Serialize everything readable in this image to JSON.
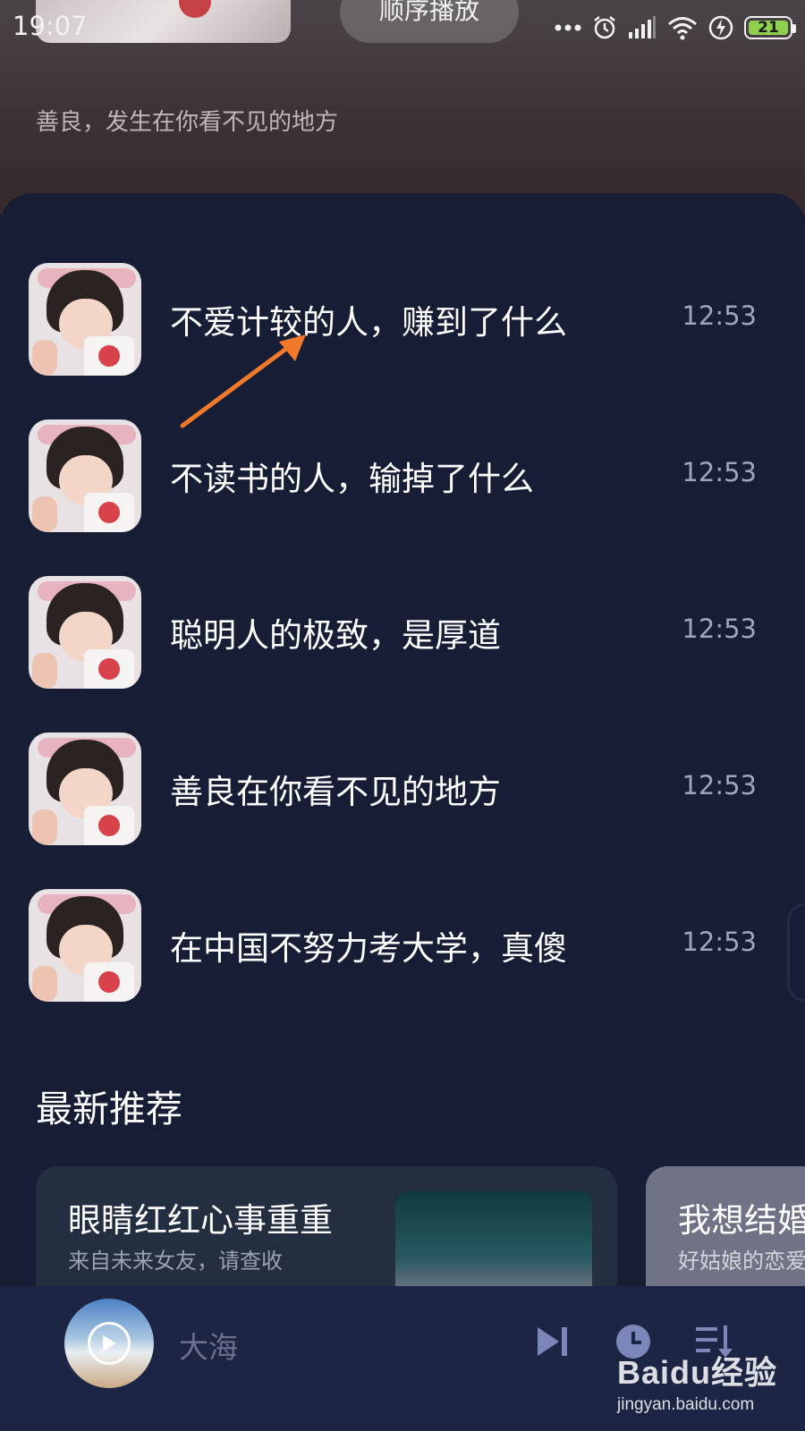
{
  "status_bar": {
    "time": "19:07",
    "battery_level": "21",
    "battery_color": "#8fd14f",
    "icons": [
      "more-dots-icon",
      "alarm-icon",
      "signal-icon",
      "wifi-icon",
      "charging-icon",
      "battery-icon"
    ]
  },
  "header": {
    "play_order_label": "顺序播放",
    "description": "善良，发生在你看不见的地方"
  },
  "episodes": [
    {
      "title": "不爱计较的人，赚到了什么",
      "duration": "12:53"
    },
    {
      "title": "不读书的人，输掉了什么",
      "duration": "12:53"
    },
    {
      "title": "聪明人的极致，是厚道",
      "duration": "12:53"
    },
    {
      "title": "善良在你看不见的地方",
      "duration": "12:53"
    },
    {
      "title": "在中国不努力考大学，真傻",
      "duration": "12:53"
    }
  ],
  "annotation": {
    "arrow_color": "#f07a2a"
  },
  "recommend": {
    "section_title": "最新推荐",
    "cards": [
      {
        "title": "眼睛红红心事重重",
        "subtitle": "来自未来女友，请查收"
      },
      {
        "title": "我想结婚",
        "subtitle": "好姑娘的恋爱"
      }
    ]
  },
  "player": {
    "now_playing": "大海",
    "controls": [
      "next-track-icon",
      "timer-icon",
      "playlist-icon"
    ]
  },
  "watermark": {
    "logo": "Baidu经验",
    "url": "jingyan.baidu.com"
  }
}
